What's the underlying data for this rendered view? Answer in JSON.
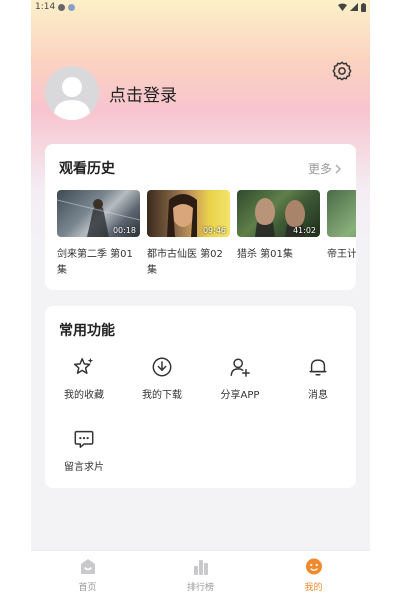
{
  "status_bar": {
    "time": "1:14"
  },
  "profile": {
    "login_label": "点击登录"
  },
  "history": {
    "title": "观看历史",
    "more_label": "更多",
    "items": [
      {
        "title": "剑来第二季 第01集",
        "duration": "00:18"
      },
      {
        "title": "都市古仙医 第02集",
        "duration": "09:46"
      },
      {
        "title": "猎杀 第01集",
        "duration": "41:02"
      },
      {
        "title": "帝王计 遗产 第",
        "duration": ""
      }
    ]
  },
  "functions": {
    "title": "常用功能",
    "items": [
      {
        "label": "我的收藏",
        "icon": "star-sparkle-icon"
      },
      {
        "label": "我的下载",
        "icon": "download-icon"
      },
      {
        "label": "分享APP",
        "icon": "share-user-icon"
      },
      {
        "label": "消息",
        "icon": "bell-icon"
      },
      {
        "label": "留言求片",
        "icon": "chat-bubble-icon"
      }
    ]
  },
  "tabbar": {
    "items": [
      {
        "label": "首页",
        "icon": "home-icon",
        "active": false
      },
      {
        "label": "排行榜",
        "icon": "ranking-icon",
        "active": false
      },
      {
        "label": "我的",
        "icon": "face-icon",
        "active": true
      }
    ],
    "active_color": "#f08a2c"
  }
}
